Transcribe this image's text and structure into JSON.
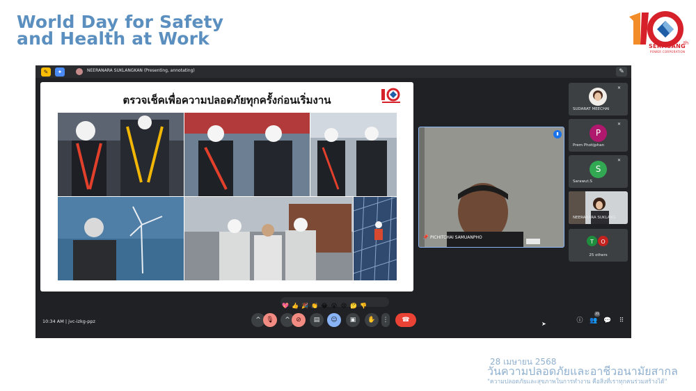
{
  "headline": {
    "line1": "World Day for Safety",
    "line2": "and Health at Work"
  },
  "brand": {
    "logo_number": "10",
    "logo_suffix": "th",
    "name": "SERMSANG",
    "sub": "POWER CORPORATION",
    "colors": {
      "red": "#d6202a",
      "orange": "#f28c28",
      "blue": "#1f5fa8"
    }
  },
  "meet": {
    "presenter_label": "NEERANARA SUKLANGKAN (Presenting, annotating)",
    "slide_title": "ตรวจเช็คเพื่อความปลอดภัยทุกครั้งก่อนเริ่มงาน",
    "self_tile": {
      "name": "PICHITCHAI SAMUANPHO"
    },
    "participants": [
      {
        "name": "SUDARAT MEECHAI",
        "type": "photo"
      },
      {
        "name": "Prem Photijphan",
        "initial": "P",
        "color": "#b0186e"
      },
      {
        "name": "Sarawut.S",
        "initial": "S",
        "color": "#33a853"
      },
      {
        "name": "NEERANARA SUKLANG",
        "type": "video"
      }
    ],
    "others": {
      "label": "25 others",
      "initials": [
        "T",
        "O"
      ]
    },
    "reactions": [
      "💖",
      "👍",
      "🎉",
      "👏",
      "😂",
      "😮",
      "😢",
      "🤔",
      "👎"
    ],
    "meeting_time": "10:34 AM  |  jvc-izkg-ppz",
    "participant_count": "31",
    "icons": {
      "mic": "mic-off-icon",
      "camera": "camera-off-icon",
      "captions": "captions-icon",
      "emoji": "emoji-icon",
      "present": "present-icon",
      "hand": "raise-hand-icon",
      "more": "more-options-icon",
      "hangup": "hang-up-icon",
      "info": "info-icon",
      "people": "people-icon",
      "chat": "chat-icon",
      "activities": "activities-icon"
    },
    "colors": {
      "background": "#202124",
      "hangup": "#ea4335",
      "muted": "#f28b82",
      "active": "#8ab4f8"
    }
  },
  "footer": {
    "date": "28 เมษายน 2568",
    "title": "วันความปลอดภัยและอาชีวอนามัยสากล",
    "quote": "\"ความปลอดภัยและสุขภาพในการทำงาน คือสิ่งที่เราทุกคนร่วมสร้างได้\""
  }
}
